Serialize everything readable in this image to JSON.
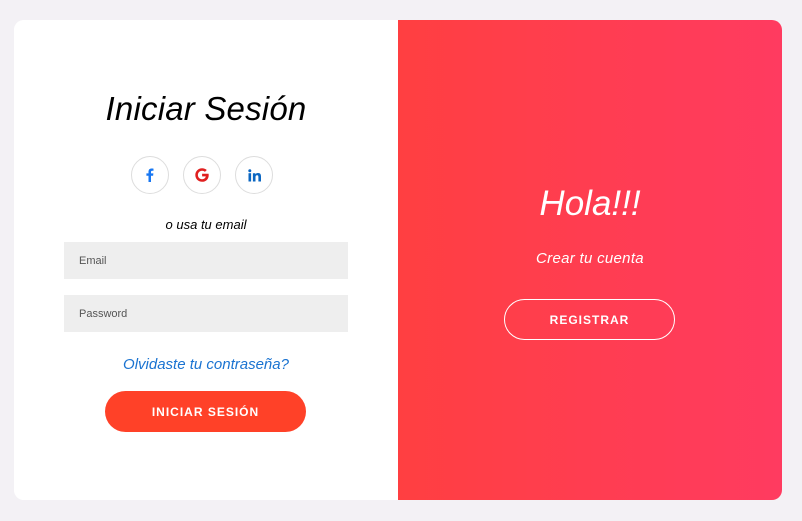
{
  "login": {
    "title": "Iniciar Sesión",
    "socials": [
      {
        "icon": "facebook-icon",
        "label": "f",
        "color": "#1877f2"
      },
      {
        "icon": "google-icon",
        "label": "G",
        "color": "#e02020"
      },
      {
        "icon": "linkedin-icon",
        "label": "in",
        "color": "#0a66c2"
      }
    ],
    "or_text": "o usa tu email",
    "email_placeholder": "Email",
    "password_placeholder": "Password",
    "forgot_link": "Olvidaste tu contraseña?",
    "submit_label": "INICIAR SESIÓN"
  },
  "register": {
    "heading": "Hola!!!",
    "subtext": "Crear tu cuenta",
    "button_label": "REGISTRAR"
  },
  "colors": {
    "page_bg": "#f3f1f5",
    "accent_gradient_start": "#ff3f41",
    "accent_gradient_end": "#ff3b60",
    "login_button": "#ff4128",
    "link": "#1a73d1"
  }
}
